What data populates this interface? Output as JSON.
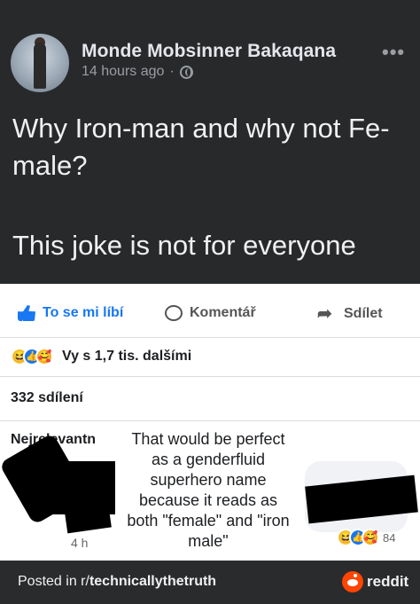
{
  "post": {
    "author": "Monde Mobsinner Bakaqana",
    "timestamp": "14 hours ago",
    "separator": "·",
    "more_label": "•••",
    "text_line1": "Why Iron-man and why not Fe-male?",
    "text_line2": "This joke is not for everyone",
    "icons": {
      "avatar": "profile-photo",
      "privacy": "globe-icon",
      "more": "more-options-icon"
    }
  },
  "actions": {
    "like_label": "To se mi líbí",
    "comment_label": "Komentář",
    "share_label": "Sdílet"
  },
  "reactions": {
    "text": "Vy s 1,7 tis. dalšími",
    "icons": [
      "haha",
      "like",
      "care"
    ]
  },
  "shares": {
    "text": "332 sdílení"
  },
  "comments": {
    "sort_label": "Nejrelevantn",
    "caption": "That would be perfect as a genderfluid superhero name because it reads as both \"female\" and \"iron male\"",
    "time": "4 h",
    "reaction_count": "84"
  },
  "footer": {
    "prefix": "Posted in r/",
    "subreddit": "technicallythetruth",
    "brand": "reddit"
  },
  "colors": {
    "post_bg": "#27292b",
    "accent": "#1877f2",
    "footer_bg": "#2a2b2d",
    "reddit": "#ff4500"
  }
}
